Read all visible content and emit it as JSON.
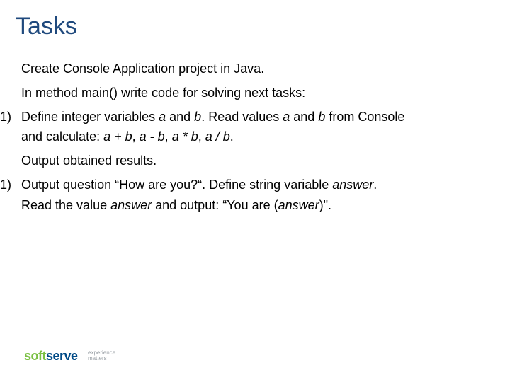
{
  "title": "Tasks",
  "p1": "Create Console Application project in Java.",
  "p2": "In method main() write code for solving next tasks:",
  "item1_num": "1)",
  "item1_a": "Define integer variables ",
  "item1_v1": "a",
  "item1_b": " and ",
  "item1_v2": "b",
  "item1_c": ". Read values ",
  "item1_v3": "a",
  "item1_d": " and ",
  "item1_v4": "b",
  "item1_e": " from Console",
  "item1_line2_a": "and calculate: ",
  "item1_line2_b": "a + b",
  "item1_line2_c": ", ",
  "item1_line2_d": "a - b",
  "item1_line2_e": ", ",
  "item1_line2_f": "a * b",
  "item1_line2_g": ", ",
  "item1_line2_h": "a / b",
  "item1_line2_i": ".",
  "item1_out": "Output obtained results.",
  "item2_num": "1)",
  "item2_a": "Output question “How are you?“. Define string variable ",
  "item2_v1": "answer",
  "item2_b": ".",
  "item2_line2_a": "Read the value ",
  "item2_line2_b": "answer",
  "item2_line2_c": " and output: “You are (",
  "item2_line2_d": "answer",
  "item2_line2_e": ")\".",
  "logo_soft": "soft",
  "logo_serve": "serve",
  "tag1": "experience",
  "tag2": "matters"
}
